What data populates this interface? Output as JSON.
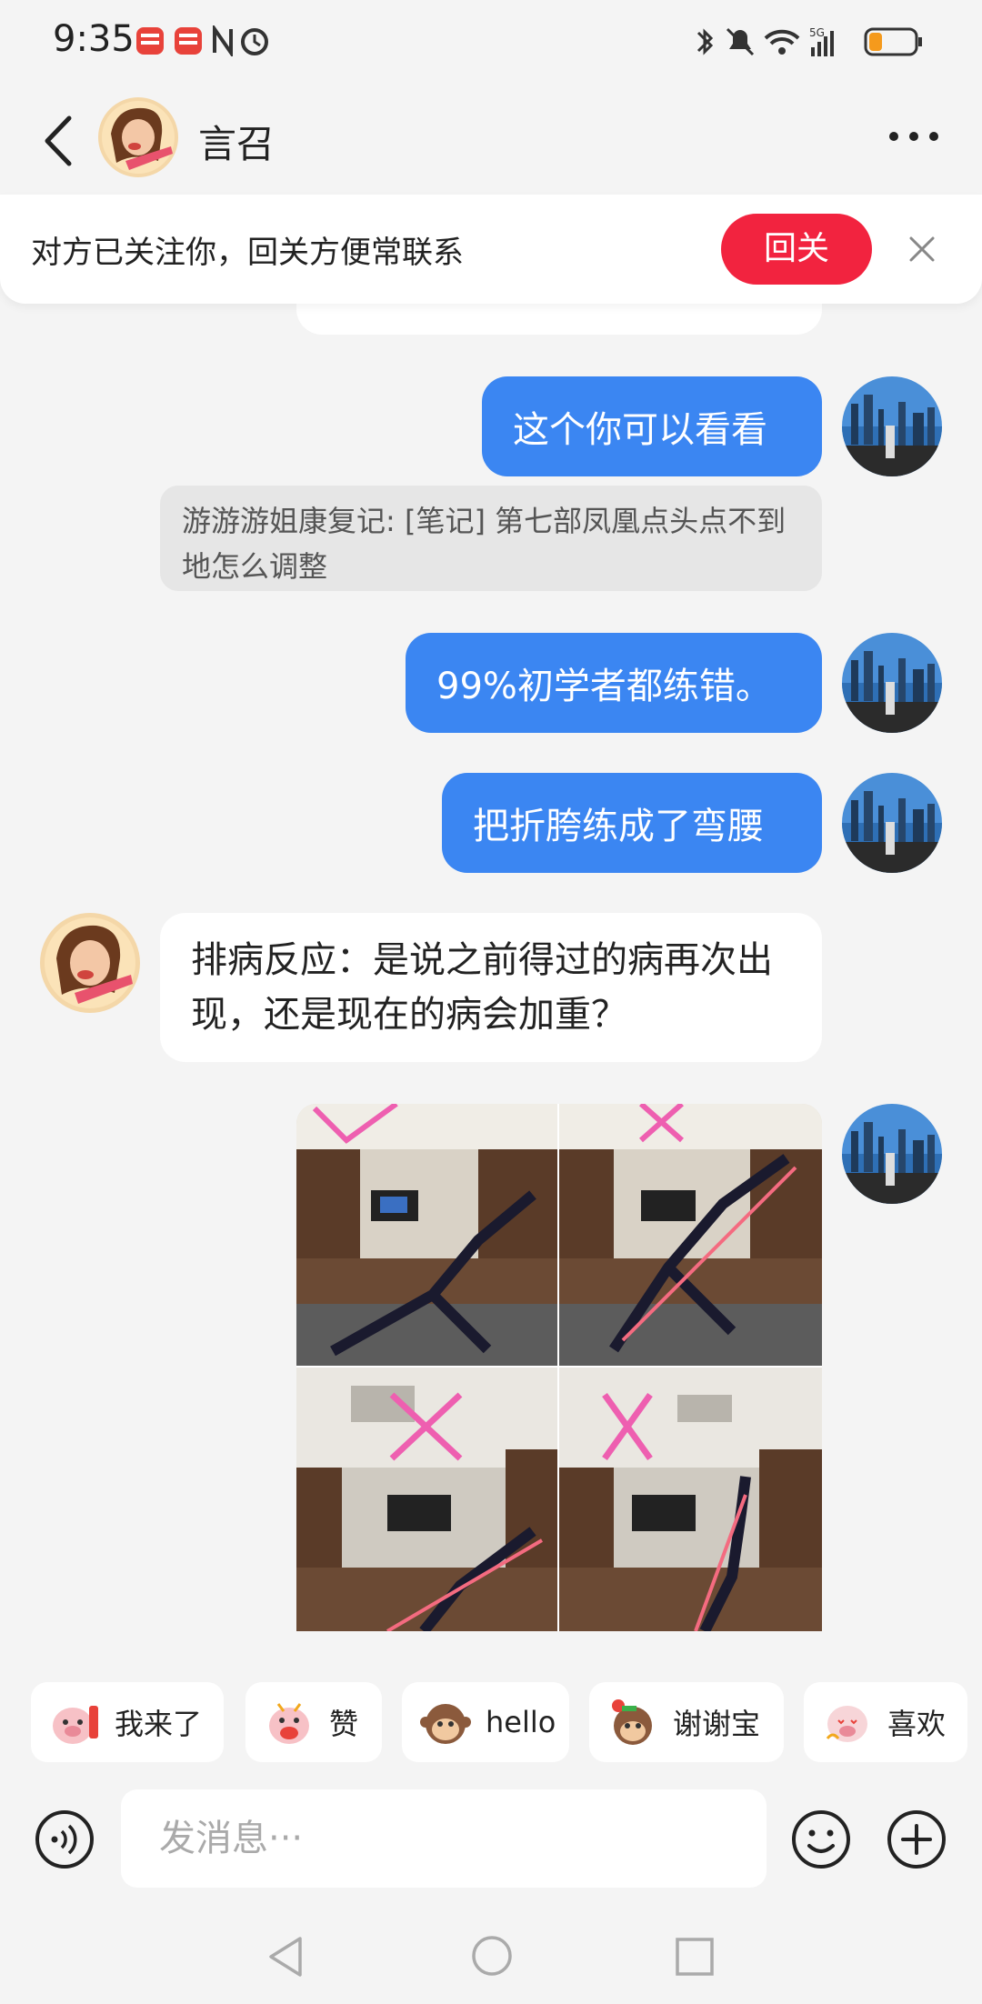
{
  "status": {
    "time": "9:35"
  },
  "contact": {
    "name": "言召"
  },
  "banner": {
    "text": "对方已关注你，回关方便常联系",
    "button": "回关"
  },
  "messages": {
    "m1": "这个你可以看看",
    "note": "游游游姐康复记: [笔记] 第七部凤凰点头点不到地怎么调整",
    "m2": "99%初学者都练错。",
    "m3": "把折胯练成了弯腰",
    "m4": "排病反应：是说之前得过的病再次出现，还是现在的病会加重？"
  },
  "quick_replies": [
    {
      "label": "我来了",
      "icon": "pig-sticker-icon"
    },
    {
      "label": "赞",
      "icon": "pig-sticker-icon"
    },
    {
      "label": "hello",
      "icon": "monkey-sticker-icon"
    },
    {
      "label": "谢谢宝",
      "icon": "monkey-sticker-icon"
    },
    {
      "label": "喜欢",
      "icon": "pig-sticker-icon"
    }
  ],
  "input": {
    "placeholder": "发消息···"
  },
  "colors": {
    "accent_blue": "#3b86f2",
    "follow_red": "#f2233f"
  }
}
